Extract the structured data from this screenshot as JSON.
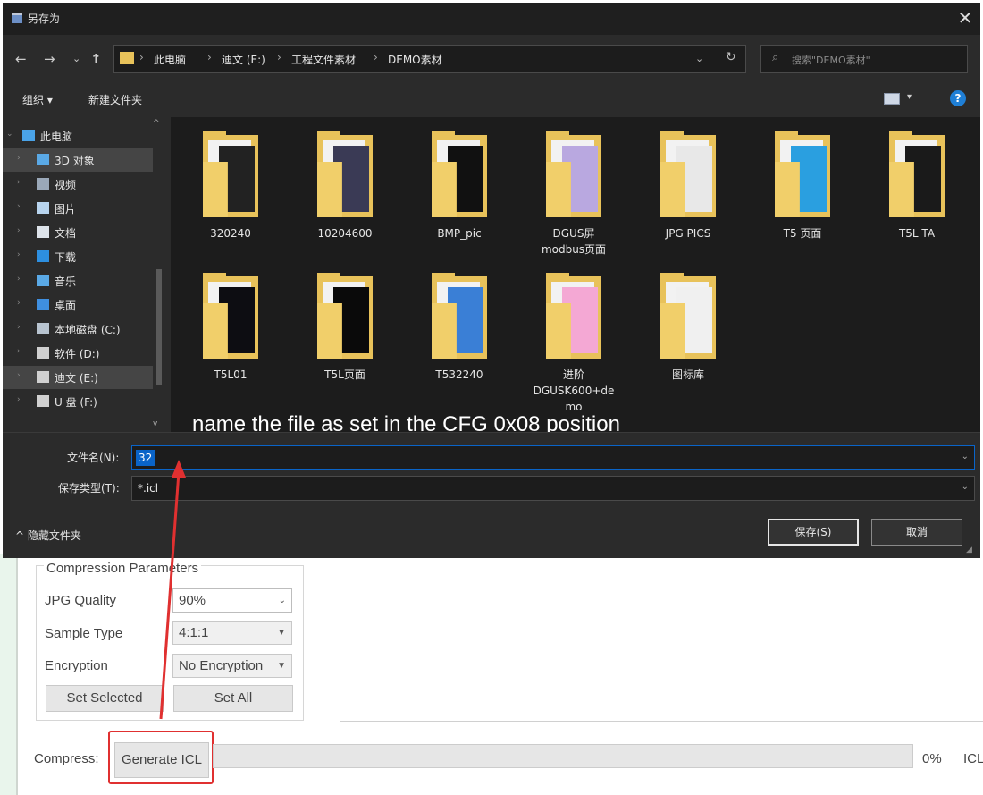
{
  "dialog": {
    "title": "另存为",
    "close_glyph": "✕",
    "nav": {
      "back": "←",
      "forward": "→",
      "recent": "⌄",
      "up": "↑"
    },
    "breadcrumb": [
      "此电脑",
      "迪文 (E:)",
      "工程文件素材",
      "DEMO素材"
    ],
    "breadcrumb_sep": "›",
    "search_placeholder": "搜索\"DEMO素材\"",
    "toolbar": {
      "organize": "组织 ▾",
      "new_folder": "新建文件夹",
      "help": "?"
    },
    "nav_tree": [
      {
        "label": "此电脑",
        "icon": "computer-icon",
        "color": "#4aa3e8"
      },
      {
        "label": "3D 对象",
        "icon": "3d-objects-icon",
        "color": "#5aa9e6",
        "selected": true
      },
      {
        "label": "视频",
        "icon": "video-icon",
        "color": "#9aa8b8"
      },
      {
        "label": "图片",
        "icon": "pictures-icon",
        "color": "#b8d4ee"
      },
      {
        "label": "文档",
        "icon": "documents-icon",
        "color": "#dde3ea"
      },
      {
        "label": "下载",
        "icon": "download-icon",
        "color": "#2d8fe0"
      },
      {
        "label": "音乐",
        "icon": "music-icon",
        "color": "#5aa9e6"
      },
      {
        "label": "桌面",
        "icon": "desktop-icon",
        "color": "#3f8fe0"
      },
      {
        "label": "本地磁盘 (C:)",
        "icon": "drive-c-icon",
        "color": "#b8c4d0"
      },
      {
        "label": "软件 (D:)",
        "icon": "drive-d-icon",
        "color": "#d0d0d0"
      },
      {
        "label": "迪文 (E:)",
        "icon": "drive-e-icon",
        "color": "#d0d0d0",
        "selected": true
      },
      {
        "label": "U 盘 (F:)",
        "icon": "usb-drive-icon",
        "color": "#d0d0d0"
      }
    ],
    "folders": [
      {
        "label": "320240",
        "accent": "#222222"
      },
      {
        "label": "10204600",
        "accent": "#3a3a55"
      },
      {
        "label": "BMP_pic",
        "accent": "#111111"
      },
      {
        "label": "DGUS屏\nmodbus页面",
        "accent": "#b9a8e0"
      },
      {
        "label": "JPG PICS",
        "accent": "#e8e8e8"
      },
      {
        "label": "T5 页面",
        "accent": "#2a9fe0"
      },
      {
        "label": "T5L TA",
        "accent": "#1a1a1a"
      },
      {
        "label": "T5L01",
        "accent": "#0d0d12"
      },
      {
        "label": "T5L页面",
        "accent": "#0a0a0a"
      },
      {
        "label": "T532240",
        "accent": "#3a7fd6"
      },
      {
        "label": "进阶\nDGUSK600+de\nmo",
        "accent": "#f4a8d4"
      },
      {
        "label": "图标库",
        "accent": "#f0f0f0"
      }
    ],
    "annotation": "name the file as set in the CFG  0x08 position",
    "filename_label": "文件名(N):",
    "filename_value": "32",
    "filetype_label": "保存类型(T):",
    "filetype_value": "*.icl",
    "hide_folders": "^ 隐藏文件夹",
    "save_button": "保存(S)",
    "cancel_button": "取消"
  },
  "app": {
    "group_title": "Compression Parameters",
    "jpg_quality_label": "JPG Quality",
    "jpg_quality_value": "90%",
    "sample_type_label": "Sample Type",
    "sample_type_value": "4:1:1",
    "encryption_label": "Encryption",
    "encryption_value": "No Encryption",
    "set_selected": "Set Selected",
    "set_all": "Set All",
    "compress_label": "Compress:",
    "generate_icl": "Generate ICL",
    "progress_percent": "0%",
    "progress_fraction": 0,
    "trailing_label": "ICL"
  },
  "colors": {
    "annotation_red": "#e03030",
    "selection_blue": "#0a64c8",
    "folder_yellow": "#e8c25a"
  }
}
